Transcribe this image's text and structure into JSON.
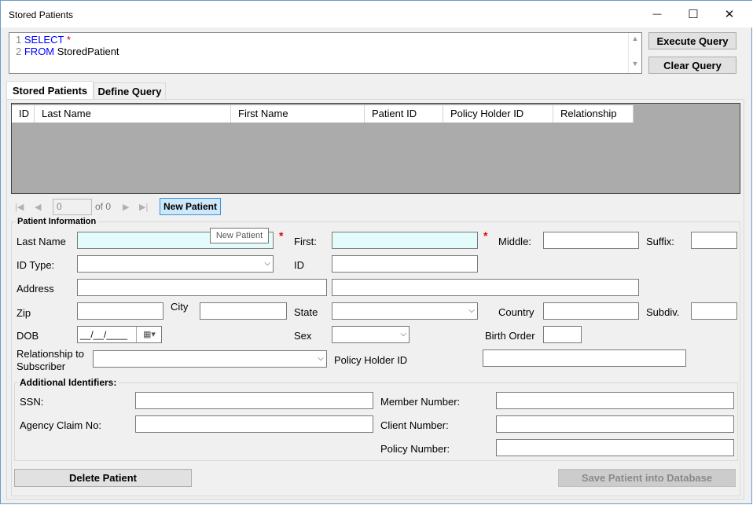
{
  "window": {
    "title": "Stored Patients",
    "minimize": "—",
    "maximize": "☐",
    "close": "✕"
  },
  "query": {
    "line1_num": "1",
    "line1_kw": "SELECT",
    "line1_star": "*",
    "line2_num": "2",
    "line2_kw": "FROM",
    "line2_text": "StoredPatient",
    "execute_label": "Execute Query",
    "clear_label": "Clear Query"
  },
  "tabs": [
    {
      "label": "Stored Patients",
      "active": true
    },
    {
      "label": "Define Query",
      "active": false
    }
  ],
  "grid": {
    "columns": [
      "ID",
      "Last Name",
      "First Name",
      "Patient ID",
      "Policy Holder ID",
      "Relationship"
    ],
    "rows": []
  },
  "navigator": {
    "position": "0",
    "of_text": "of 0",
    "new_patient_label": "New Patient",
    "tooltip": "New Patient"
  },
  "patient_info": {
    "group_label": "Patient Information",
    "last_name_label": "Last Name",
    "first_label": "First:",
    "middle_label": "Middle:",
    "suffix_label": "Suffix:",
    "id_type_label": "ID Type:",
    "id_label": "ID",
    "address_label": "Address",
    "zip_label": "Zip",
    "city_label": "City",
    "state_label": "State",
    "country_label": "Country",
    "subdiv_label": "Subdiv.",
    "dob_label": "DOB",
    "dob_value": "__/__/____",
    "sex_label": "Sex",
    "birth_order_label": "Birth Order",
    "relationship_label_1": "Relationship to",
    "relationship_label_2": "Subscriber",
    "policy_holder_label": "Policy Holder ID",
    "required_mark": "*"
  },
  "additional": {
    "group_label": "Additional Identifiers:",
    "ssn_label": "SSN:",
    "agency_label": "Agency Claim No:",
    "member_label": "Member Number:",
    "client_label": "Client Number:",
    "policy_label": "Policy Number:"
  },
  "actions": {
    "delete_label": "Delete Patient",
    "save_label": "Save Patient into Database"
  },
  "colors": {
    "required_field_bg": "#e3fbfb",
    "keyword_blue": "#0000ff",
    "new_patient_bg": "#cde8fb"
  }
}
